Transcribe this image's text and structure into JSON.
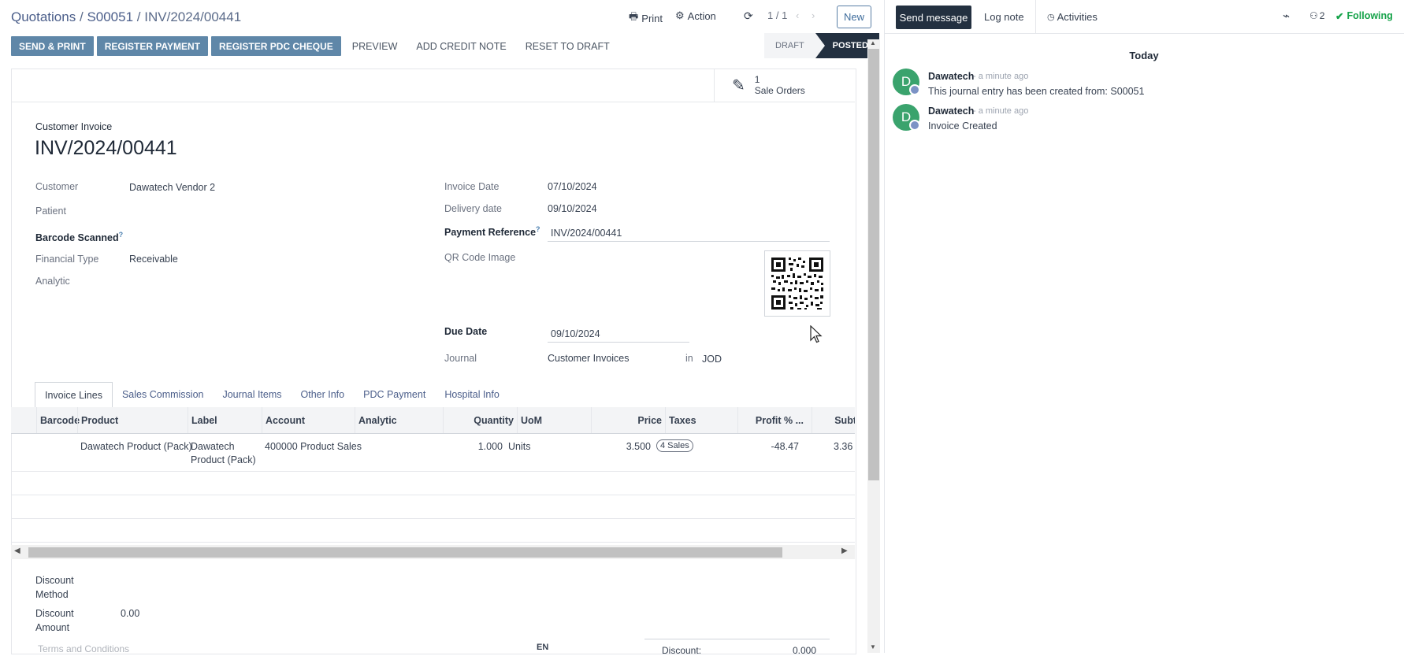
{
  "breadcrumb": {
    "part1": "Quotations",
    "sep": "/",
    "part2": "S00051",
    "current": "INV/2024/00441"
  },
  "toolbar": {
    "print": "Print",
    "action": "Action",
    "pager": "1 / 1",
    "new": "New"
  },
  "actions": {
    "send_print": "SEND & PRINT",
    "register_payment": "REGISTER PAYMENT",
    "register_pdc": "REGISTER PDC CHEQUE",
    "preview": "PREVIEW",
    "add_credit_note": "ADD CREDIT NOTE",
    "reset_to_draft": "RESET TO DRAFT"
  },
  "status": {
    "draft": "DRAFT",
    "posted": "POSTED"
  },
  "smart_button": {
    "count": "1",
    "label": "Sale Orders"
  },
  "invoice": {
    "type": "Customer Invoice",
    "number": "INV/2024/00441",
    "customer_label": "Customer",
    "customer": "Dawatech Vendor 2",
    "patient_label": "Patient",
    "barcode_label": "Barcode Scanned",
    "financial_type_label": "Financial Type",
    "financial_type": "Receivable",
    "analytic_label": "Analytic",
    "invoice_date_label": "Invoice Date",
    "invoice_date": "07/10/2024",
    "delivery_date_label": "Delivery date",
    "delivery_date": "09/10/2024",
    "payment_ref_label": "Payment Reference",
    "payment_ref": "INV/2024/00441",
    "qr_label": "QR Code Image",
    "due_date_label": "Due Date",
    "due_date": "09/10/2024",
    "journal_label": "Journal",
    "journal": "Customer Invoices",
    "journal_in": "in",
    "currency": "JOD",
    "help_mark": "?"
  },
  "tabs": [
    "Invoice Lines",
    "Sales Commission",
    "Journal Items",
    "Other Info",
    "PDC Payment",
    "Hospital Info"
  ],
  "table": {
    "headers": {
      "barcode": "Barcode",
      "product": "Product",
      "label": "Label",
      "account": "Account",
      "analytic": "Analytic",
      "quantity": "Quantity",
      "uom": "UoM",
      "price": "Price",
      "taxes": "Taxes",
      "profit": "Profit % ...",
      "subtotal": "Subt"
    },
    "row": {
      "product": "Dawatech Product (Pack)",
      "label_line1": "Dawatech",
      "label_line2": "Product (Pack)",
      "account": "400000 Product Sales",
      "quantity": "1.000",
      "uom": "Units",
      "price": "3.500",
      "tax": "4 Sales",
      "profit": "-48.47",
      "subtotal": "3.36"
    }
  },
  "footer": {
    "discount_method_label_1": "Discount",
    "discount_method_label_2": "Method",
    "discount_amount_label_1": "Discount",
    "discount_amount_label_2": "Amount",
    "discount_amount": "0.00",
    "terms": "Terms and Conditions",
    "lang": "EN",
    "discount_total_label": "Discount:",
    "discount_total": "0.000"
  },
  "chatter": {
    "send_message": "Send message",
    "log_note": "Log note",
    "activities": "Activities",
    "followers_count": "2",
    "following": "Following",
    "today": "Today",
    "messages": [
      {
        "initial": "D",
        "author": "Dawatech",
        "time": "- a minute ago",
        "body": "This journal entry has been created from: S00051"
      },
      {
        "initial": "D",
        "author": "Dawatech",
        "time": "- a minute ago",
        "body": "Invoice Created"
      }
    ]
  },
  "colors": {
    "primary_button": "#5f87a8",
    "dark": "#233040",
    "avatar": "#3aa36d"
  }
}
